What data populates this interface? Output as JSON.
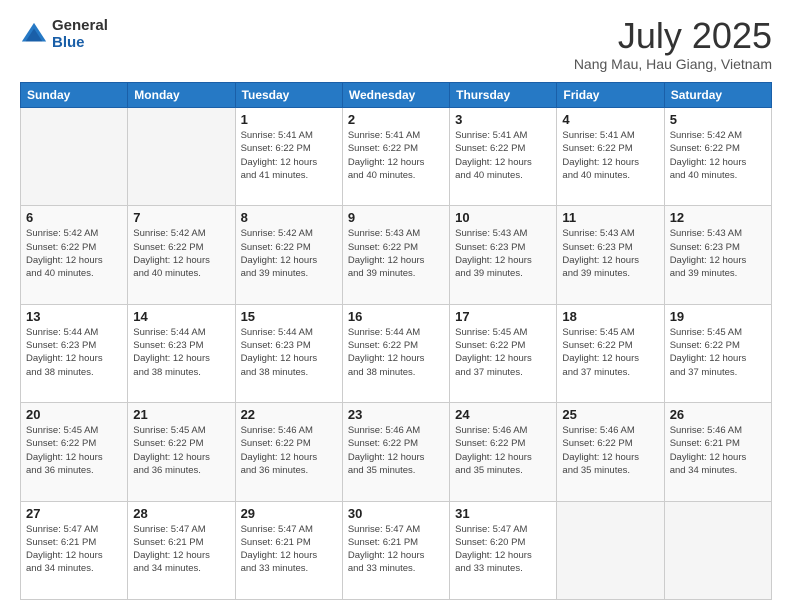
{
  "header": {
    "logo_general": "General",
    "logo_blue": "Blue",
    "title": "July 2025",
    "location": "Nang Mau, Hau Giang, Vietnam"
  },
  "weekdays": [
    "Sunday",
    "Monday",
    "Tuesday",
    "Wednesday",
    "Thursday",
    "Friday",
    "Saturday"
  ],
  "weeks": [
    [
      {
        "day": "",
        "info": ""
      },
      {
        "day": "",
        "info": ""
      },
      {
        "day": "1",
        "info": "Sunrise: 5:41 AM\nSunset: 6:22 PM\nDaylight: 12 hours\nand 41 minutes."
      },
      {
        "day": "2",
        "info": "Sunrise: 5:41 AM\nSunset: 6:22 PM\nDaylight: 12 hours\nand 40 minutes."
      },
      {
        "day": "3",
        "info": "Sunrise: 5:41 AM\nSunset: 6:22 PM\nDaylight: 12 hours\nand 40 minutes."
      },
      {
        "day": "4",
        "info": "Sunrise: 5:41 AM\nSunset: 6:22 PM\nDaylight: 12 hours\nand 40 minutes."
      },
      {
        "day": "5",
        "info": "Sunrise: 5:42 AM\nSunset: 6:22 PM\nDaylight: 12 hours\nand 40 minutes."
      }
    ],
    [
      {
        "day": "6",
        "info": "Sunrise: 5:42 AM\nSunset: 6:22 PM\nDaylight: 12 hours\nand 40 minutes."
      },
      {
        "day": "7",
        "info": "Sunrise: 5:42 AM\nSunset: 6:22 PM\nDaylight: 12 hours\nand 40 minutes."
      },
      {
        "day": "8",
        "info": "Sunrise: 5:42 AM\nSunset: 6:22 PM\nDaylight: 12 hours\nand 39 minutes."
      },
      {
        "day": "9",
        "info": "Sunrise: 5:43 AM\nSunset: 6:22 PM\nDaylight: 12 hours\nand 39 minutes."
      },
      {
        "day": "10",
        "info": "Sunrise: 5:43 AM\nSunset: 6:23 PM\nDaylight: 12 hours\nand 39 minutes."
      },
      {
        "day": "11",
        "info": "Sunrise: 5:43 AM\nSunset: 6:23 PM\nDaylight: 12 hours\nand 39 minutes."
      },
      {
        "day": "12",
        "info": "Sunrise: 5:43 AM\nSunset: 6:23 PM\nDaylight: 12 hours\nand 39 minutes."
      }
    ],
    [
      {
        "day": "13",
        "info": "Sunrise: 5:44 AM\nSunset: 6:23 PM\nDaylight: 12 hours\nand 38 minutes."
      },
      {
        "day": "14",
        "info": "Sunrise: 5:44 AM\nSunset: 6:23 PM\nDaylight: 12 hours\nand 38 minutes."
      },
      {
        "day": "15",
        "info": "Sunrise: 5:44 AM\nSunset: 6:23 PM\nDaylight: 12 hours\nand 38 minutes."
      },
      {
        "day": "16",
        "info": "Sunrise: 5:44 AM\nSunset: 6:22 PM\nDaylight: 12 hours\nand 38 minutes."
      },
      {
        "day": "17",
        "info": "Sunrise: 5:45 AM\nSunset: 6:22 PM\nDaylight: 12 hours\nand 37 minutes."
      },
      {
        "day": "18",
        "info": "Sunrise: 5:45 AM\nSunset: 6:22 PM\nDaylight: 12 hours\nand 37 minutes."
      },
      {
        "day": "19",
        "info": "Sunrise: 5:45 AM\nSunset: 6:22 PM\nDaylight: 12 hours\nand 37 minutes."
      }
    ],
    [
      {
        "day": "20",
        "info": "Sunrise: 5:45 AM\nSunset: 6:22 PM\nDaylight: 12 hours\nand 36 minutes."
      },
      {
        "day": "21",
        "info": "Sunrise: 5:45 AM\nSunset: 6:22 PM\nDaylight: 12 hours\nand 36 minutes."
      },
      {
        "day": "22",
        "info": "Sunrise: 5:46 AM\nSunset: 6:22 PM\nDaylight: 12 hours\nand 36 minutes."
      },
      {
        "day": "23",
        "info": "Sunrise: 5:46 AM\nSunset: 6:22 PM\nDaylight: 12 hours\nand 35 minutes."
      },
      {
        "day": "24",
        "info": "Sunrise: 5:46 AM\nSunset: 6:22 PM\nDaylight: 12 hours\nand 35 minutes."
      },
      {
        "day": "25",
        "info": "Sunrise: 5:46 AM\nSunset: 6:22 PM\nDaylight: 12 hours\nand 35 minutes."
      },
      {
        "day": "26",
        "info": "Sunrise: 5:46 AM\nSunset: 6:21 PM\nDaylight: 12 hours\nand 34 minutes."
      }
    ],
    [
      {
        "day": "27",
        "info": "Sunrise: 5:47 AM\nSunset: 6:21 PM\nDaylight: 12 hours\nand 34 minutes."
      },
      {
        "day": "28",
        "info": "Sunrise: 5:47 AM\nSunset: 6:21 PM\nDaylight: 12 hours\nand 34 minutes."
      },
      {
        "day": "29",
        "info": "Sunrise: 5:47 AM\nSunset: 6:21 PM\nDaylight: 12 hours\nand 33 minutes."
      },
      {
        "day": "30",
        "info": "Sunrise: 5:47 AM\nSunset: 6:21 PM\nDaylight: 12 hours\nand 33 minutes."
      },
      {
        "day": "31",
        "info": "Sunrise: 5:47 AM\nSunset: 6:20 PM\nDaylight: 12 hours\nand 33 minutes."
      },
      {
        "day": "",
        "info": ""
      },
      {
        "day": "",
        "info": ""
      }
    ]
  ]
}
